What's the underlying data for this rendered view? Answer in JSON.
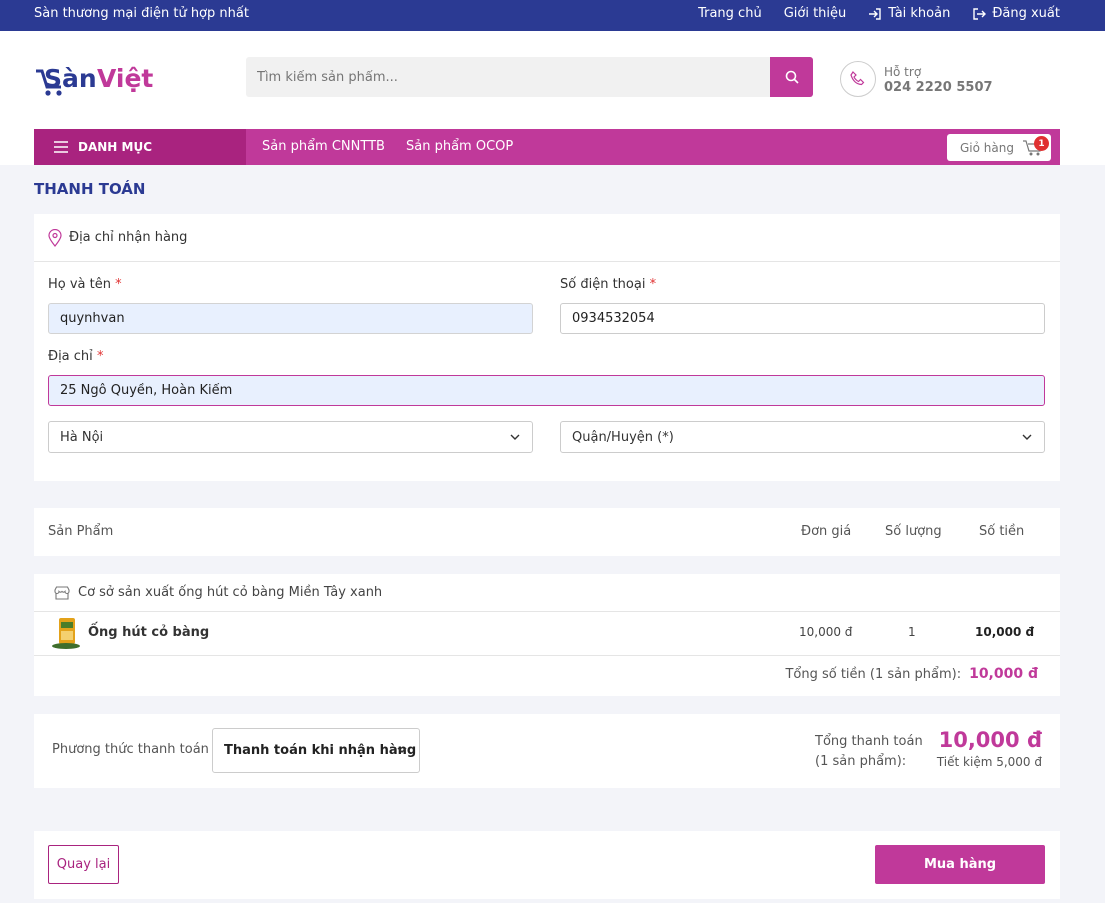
{
  "topbar": {
    "tagline": "Sàn thương mại điện tử hợp nhất",
    "links": {
      "home": "Trang chủ",
      "about": "Giới thiệu",
      "account": "Tài khoản",
      "logout": "Đăng xuất"
    }
  },
  "brand": {
    "part1": "Sàn",
    "part2": "Việt"
  },
  "search": {
    "placeholder": "Tìm kiếm sản phẩm..."
  },
  "support": {
    "label": "Hỗ trợ",
    "phone": "024 2220 5507"
  },
  "nav": {
    "category": "DANH MỤC",
    "items": [
      "Sản phẩm CNNTTB",
      "Sản phẩm OCOP"
    ],
    "cart_label": "Giỏ hàng",
    "cart_count": "1"
  },
  "page_title": "THANH TOÁN",
  "address": {
    "section_title": "Địa chỉ nhận hàng",
    "name_label": "Họ và tên",
    "name_value": "quynhvan",
    "phone_label": "Số điện thoại",
    "phone_value": "0934532054",
    "addr_label": "Địa chỉ",
    "addr_value": "25 Ngô Quyền, Hoàn Kiếm",
    "required_mark": "*",
    "city_selected": "Hà Nội",
    "district_placeholder": "Quận/Huyện (*)"
  },
  "products_header": {
    "product": "Sản Phẩm",
    "unit_price": "Đơn giá",
    "quantity": "Số lượng",
    "amount": "Số tiền"
  },
  "shop": {
    "name": "Cơ sở sản xuất ống hút cỏ bàng Miền Tây xanh",
    "items": [
      {
        "name": "Ống hút cỏ bàng",
        "unit_price": "10,000 đ",
        "quantity": "1",
        "amount": "10,000 đ"
      }
    ],
    "total_label": "Tổng số tiền (1 sản phẩm):",
    "total_value": "10,000 đ"
  },
  "payment": {
    "label": "Phương thức thanh toán",
    "selected": "Thanh toán khi nhận hàng",
    "summary_line1": "Tổng thanh toán",
    "summary_line2": "(1 sản phẩm):",
    "total": "10,000 đ",
    "saving": "Tiết kiệm 5,000 đ"
  },
  "actions": {
    "back": "Quay lại",
    "buy": "Mua hàng"
  },
  "colors": {
    "primary_navy": "#2b3a93",
    "accent_magenta": "#c0399a",
    "dark_magenta": "#a9237f"
  }
}
